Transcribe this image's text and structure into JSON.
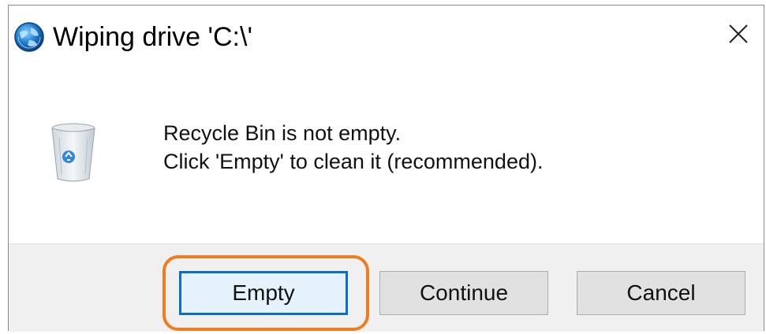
{
  "window": {
    "title": "Wiping drive 'C:\\'",
    "app_icon": "globe-icon",
    "close_icon": "close-icon"
  },
  "message": {
    "icon": "recycle-bin-icon",
    "line1": "Recycle Bin is not empty.",
    "line2": "Click 'Empty' to clean it (recommended)."
  },
  "buttons": {
    "empty": "Empty",
    "continue": "Continue",
    "cancel": "Cancel"
  },
  "colors": {
    "highlight": "#ee7d22",
    "default_button_border": "#0a6ec8"
  }
}
